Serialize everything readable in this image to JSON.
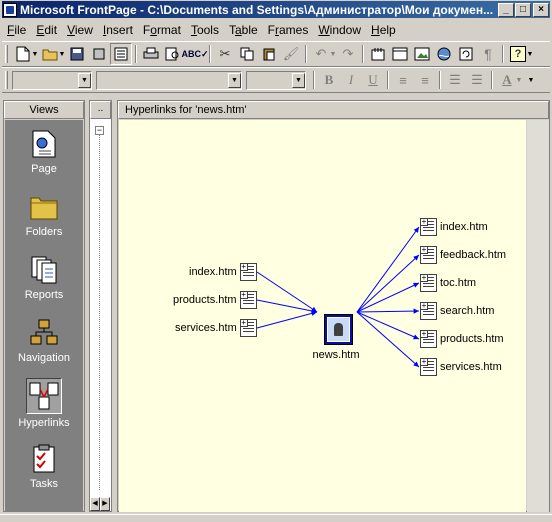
{
  "window": {
    "title": "Microsoft FrontPage - C:\\Documents and Settings\\Администратор\\Мои докумен..."
  },
  "menu": [
    {
      "label": "File",
      "key": "F"
    },
    {
      "label": "Edit",
      "key": "E"
    },
    {
      "label": "View",
      "key": "V"
    },
    {
      "label": "Insert",
      "key": "I"
    },
    {
      "label": "Format",
      "key": "o"
    },
    {
      "label": "Tools",
      "key": "T"
    },
    {
      "label": "Table",
      "key": "a"
    },
    {
      "label": "Frames",
      "key": "r"
    },
    {
      "label": "Window",
      "key": "W"
    },
    {
      "label": "Help",
      "key": "H"
    }
  ],
  "formatting": {
    "bold": "B",
    "italic": "I",
    "underline": "U",
    "font_color": "A"
  },
  "views_panel": {
    "header": "Views",
    "items": [
      {
        "label": "Page",
        "icon": "page-view-icon"
      },
      {
        "label": "Folders",
        "icon": "folder-icon"
      },
      {
        "label": "Reports",
        "icon": "reports-icon"
      },
      {
        "label": "Navigation",
        "icon": "navigation-icon"
      },
      {
        "label": "Hyperlinks",
        "icon": "hyperlinks-icon",
        "selected": true
      },
      {
        "label": "Tasks",
        "icon": "tasks-icon"
      }
    ]
  },
  "folder_pane": {
    "header": ".."
  },
  "main": {
    "header": "Hyperlinks for 'news.htm'",
    "center": "news.htm",
    "incoming": [
      "index.htm",
      "products.htm",
      "services.htm"
    ],
    "outgoing": [
      "index.htm",
      "feedback.htm",
      "toc.htm",
      "search.htm",
      "products.htm",
      "services.htm"
    ]
  },
  "colors": {
    "title_bar": "#0a246a",
    "canvas": "#ffffe1",
    "link_line": "#0000ff",
    "views_background": "#808080"
  }
}
